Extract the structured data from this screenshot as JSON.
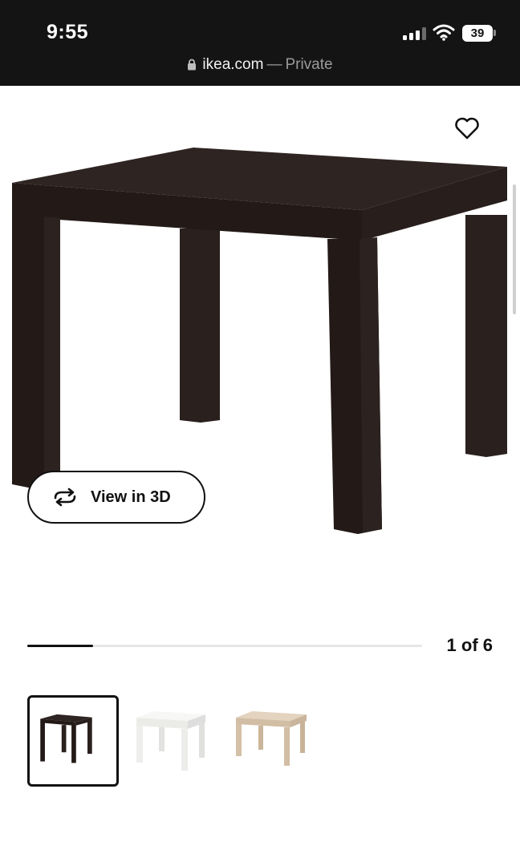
{
  "status_bar": {
    "time": "9:55",
    "battery": "39",
    "url_domain": "ikea.com",
    "url_separator": "—",
    "url_mode": "Private",
    "icons": [
      "cellular-signal-icon",
      "wifi-icon",
      "battery-icon",
      "lock-icon"
    ]
  },
  "product": {
    "image_subject": "side-table-black-brown",
    "favorite_icon": "heart-outline-icon",
    "view_3d_label": "View in 3D",
    "view_3d_icon": "rotate-arrows-icon"
  },
  "gallery": {
    "current_page": 1,
    "total_pages": 6,
    "page_label": "1 of 6",
    "progress_fraction": 0.166,
    "thumbnails": [
      {
        "name": "thumbnail-black-brown",
        "color": "#2e2421",
        "selected": true
      },
      {
        "name": "thumbnail-white",
        "color": "#f4f4f2",
        "selected": false
      },
      {
        "name": "thumbnail-white-stained-oak",
        "color": "#d9c7b0",
        "selected": false
      }
    ]
  },
  "colors": {
    "status_bg": "#141414",
    "table_top": "#2e2421",
    "table_front": "#231a18",
    "text": "#111111"
  }
}
